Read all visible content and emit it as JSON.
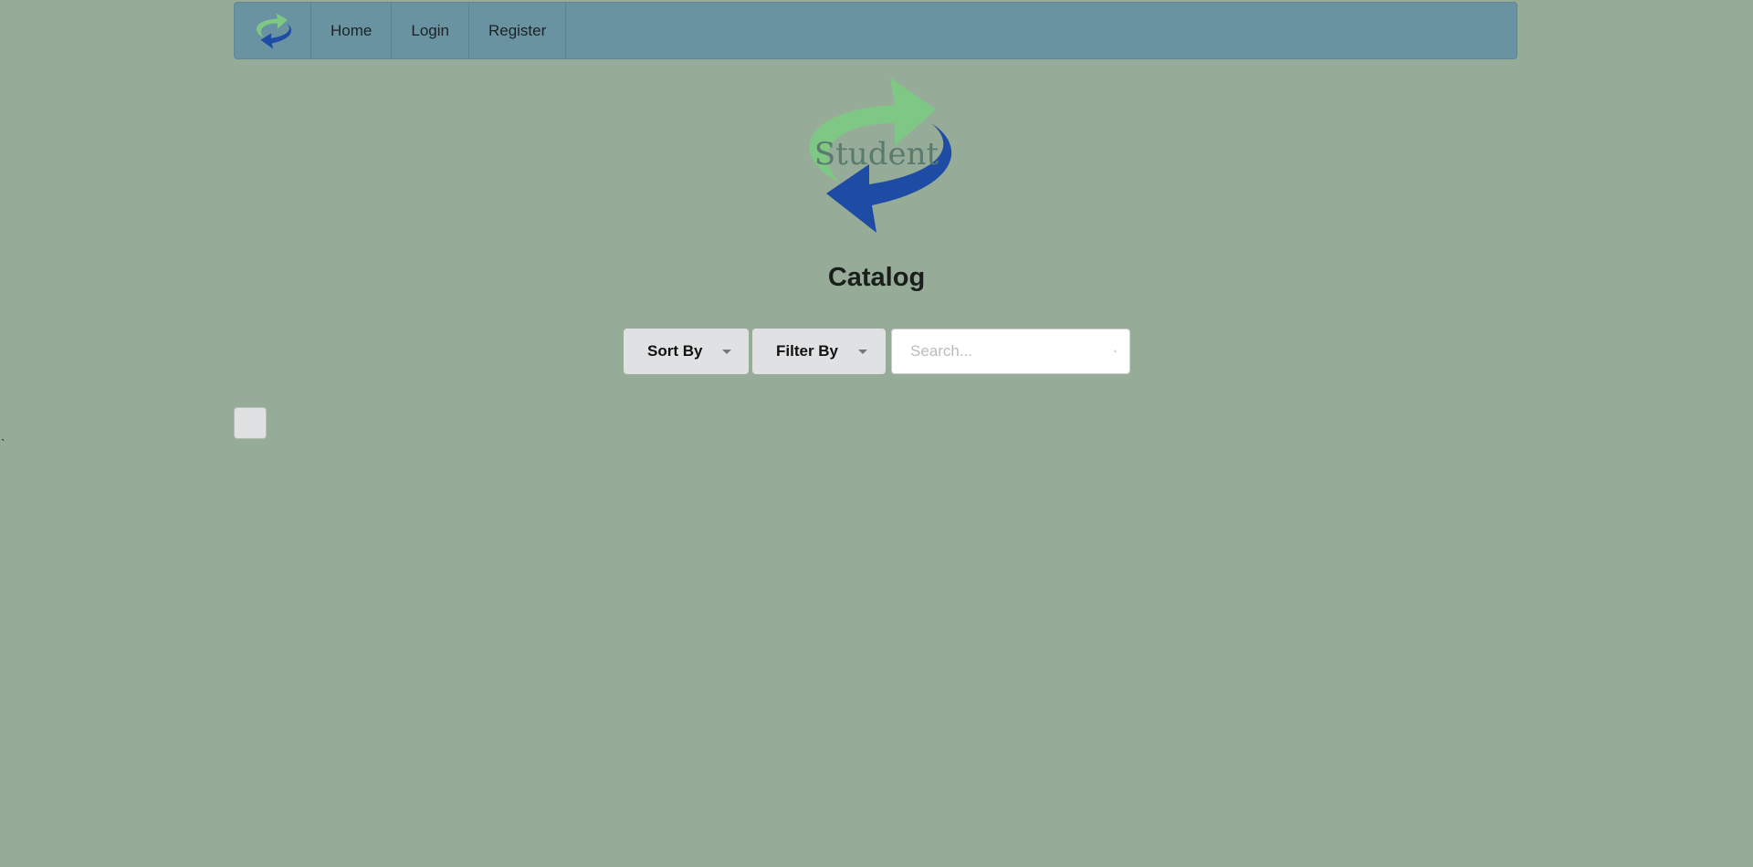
{
  "nav": {
    "items": [
      {
        "label": "Home"
      },
      {
        "label": "Login"
      },
      {
        "label": "Register"
      }
    ]
  },
  "logo": {
    "text": "Student"
  },
  "page": {
    "title": "Catalog"
  },
  "controls": {
    "sort_label": "Sort By",
    "filter_label": "Filter By",
    "search_placeholder": "Search..."
  },
  "misc": {
    "stray_char": "`"
  },
  "colors": {
    "background": "#97ac98",
    "nav": "#6993a0",
    "green_arrow": "#7ec784",
    "blue_arrow": "#1e4ba3"
  }
}
